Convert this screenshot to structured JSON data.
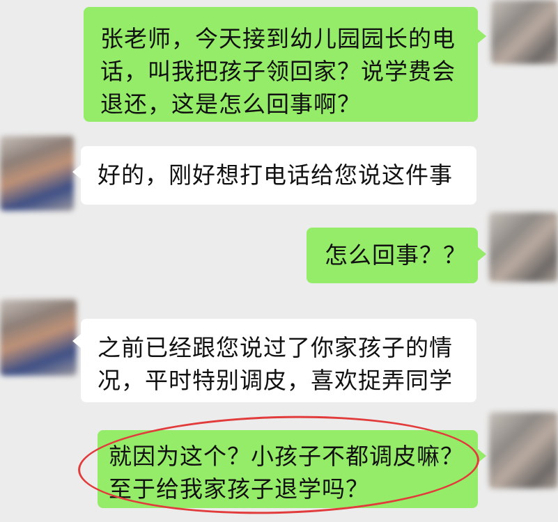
{
  "messages": [
    {
      "side": "me",
      "lines": [
        "张老师，今天接到幼儿园园长的电",
        "话，叫我把孩子领回家？说学费会",
        "退还，这是怎么回事啊？"
      ]
    },
    {
      "side": "them",
      "lines": [
        "好的，刚好想打电话给您说这件事"
      ]
    },
    {
      "side": "me",
      "lines": [
        "怎么回事？？"
      ]
    },
    {
      "side": "them",
      "lines": [
        "之前已经跟您说过了你家孩子的情",
        "况，平时特别调皮，喜欢捉弄同学"
      ]
    },
    {
      "side": "me",
      "lines": [
        "就因为这个？小孩子不都调皮嘛？",
        "至于给我家孩子退学吗？"
      ]
    }
  ],
  "colors": {
    "background": "#ececec",
    "my_bubble": "#95ec69",
    "their_bubble": "#ffffff",
    "highlight": "#e23b3b"
  }
}
